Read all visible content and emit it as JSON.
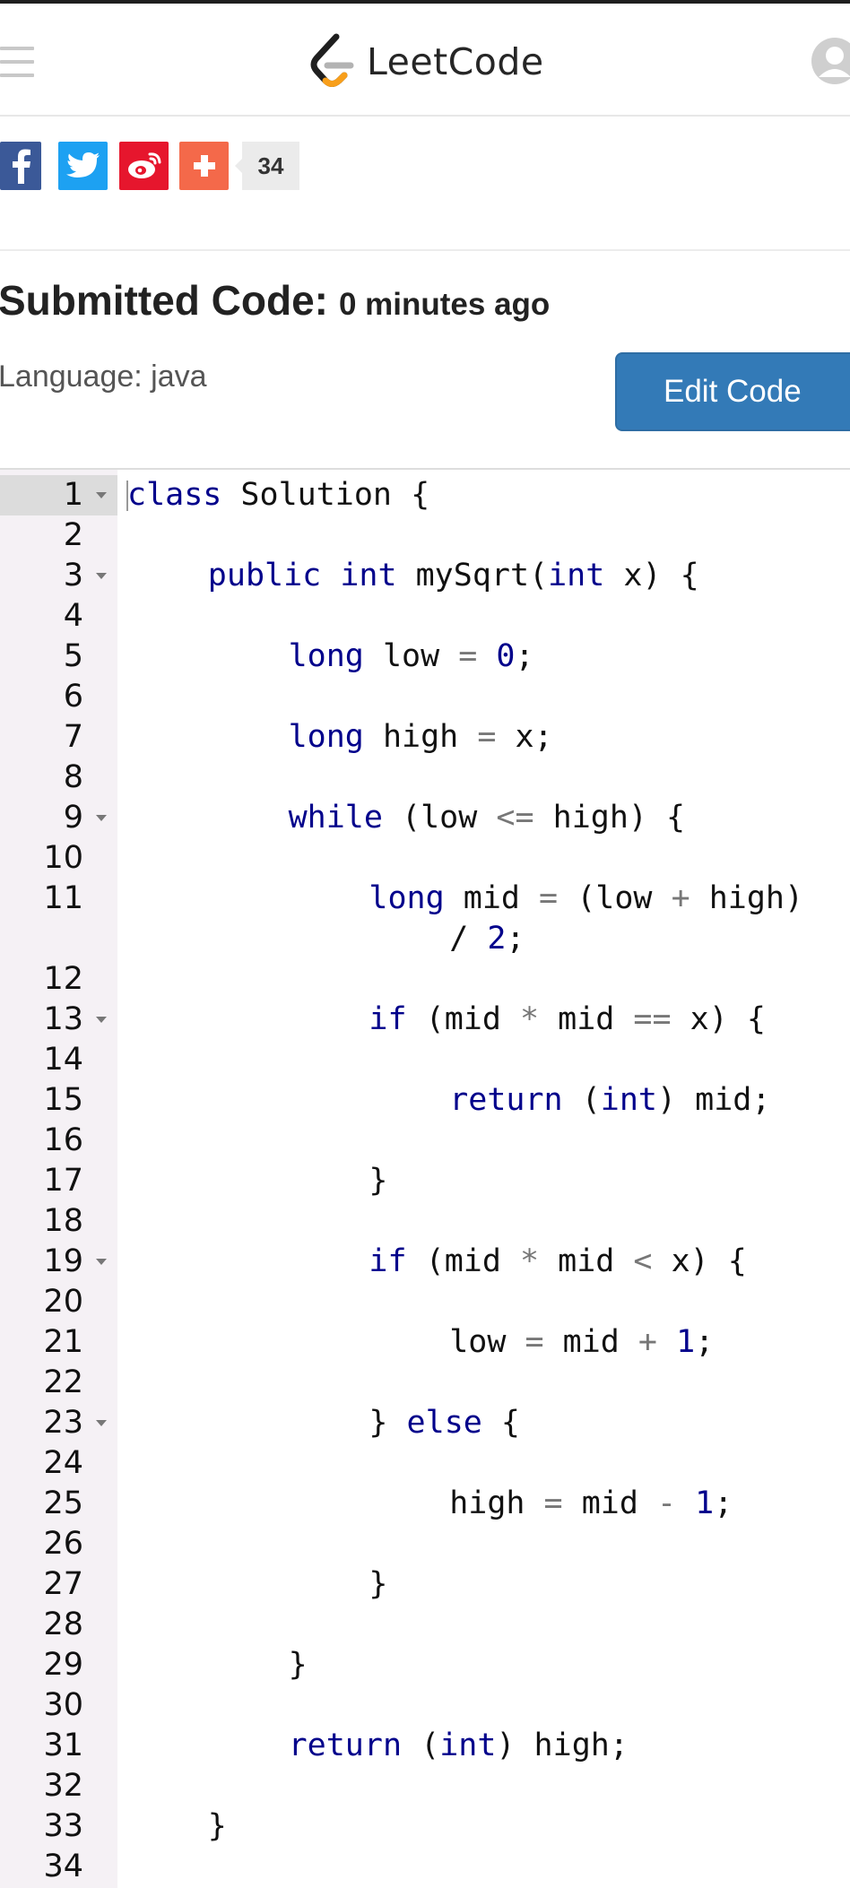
{
  "header": {
    "logo_text": "LeetCode",
    "menu_icon": "hamburger-icon",
    "avatar_icon": "user-avatar-icon"
  },
  "share": {
    "buttons": [
      {
        "name": "facebook",
        "icon": "facebook-icon",
        "color": "#3b5998"
      },
      {
        "name": "twitter",
        "icon": "twitter-icon",
        "color": "#1da1f2"
      },
      {
        "name": "weibo",
        "icon": "weibo-icon",
        "color": "#e6162d"
      },
      {
        "name": "more",
        "icon": "plus-icon",
        "color": "#f4694a"
      }
    ],
    "count": "34"
  },
  "submission": {
    "title": "Submitted Code:",
    "time_ago": "0 minutes ago",
    "language_label": "Language: java",
    "edit_button": "Edit Code",
    "edit_button_color": "#337ab7"
  },
  "editor": {
    "lines": [
      {
        "n": "1",
        "fold": true,
        "indent": 0,
        "tokens": [
          [
            "kw",
            "class"
          ],
          [
            "t",
            " Solution {"
          ]
        ]
      },
      {
        "n": "2",
        "fold": false,
        "indent": 0,
        "tokens": []
      },
      {
        "n": "3",
        "fold": true,
        "indent": 4,
        "tokens": [
          [
            "kw",
            "public"
          ],
          [
            "t",
            " "
          ],
          [
            "kw",
            "int"
          ],
          [
            "t",
            " mySqrt("
          ],
          [
            "kw",
            "int"
          ],
          [
            "t",
            " x) {"
          ]
        ]
      },
      {
        "n": "4",
        "fold": false,
        "indent": 0,
        "tokens": []
      },
      {
        "n": "5",
        "fold": false,
        "indent": 8,
        "tokens": [
          [
            "kw",
            "long"
          ],
          [
            "t",
            " low "
          ],
          [
            "op",
            "="
          ],
          [
            "t",
            " "
          ],
          [
            "num",
            "0"
          ],
          [
            "t",
            ";"
          ]
        ]
      },
      {
        "n": "6",
        "fold": false,
        "indent": 0,
        "tokens": []
      },
      {
        "n": "7",
        "fold": false,
        "indent": 8,
        "tokens": [
          [
            "kw",
            "long"
          ],
          [
            "t",
            " high "
          ],
          [
            "op",
            "="
          ],
          [
            "t",
            " x;"
          ]
        ]
      },
      {
        "n": "8",
        "fold": false,
        "indent": 0,
        "tokens": []
      },
      {
        "n": "9",
        "fold": true,
        "indent": 8,
        "tokens": [
          [
            "kw",
            "while"
          ],
          [
            "t",
            " (low "
          ],
          [
            "op",
            "<="
          ],
          [
            "t",
            " high) {"
          ]
        ]
      },
      {
        "n": "10",
        "fold": false,
        "indent": 0,
        "tokens": []
      },
      {
        "n": "11",
        "fold": false,
        "indent": 12,
        "tokens": [
          [
            "kw",
            "long"
          ],
          [
            "t",
            " mid "
          ],
          [
            "op",
            "="
          ],
          [
            "t",
            " (low "
          ],
          [
            "op",
            "+"
          ],
          [
            "t",
            " high)"
          ]
        ]
      },
      {
        "n": "",
        "fold": false,
        "indent": 16,
        "tokens": [
          [
            "t",
            "/ "
          ],
          [
            "num",
            "2"
          ],
          [
            "t",
            ";"
          ]
        ]
      },
      {
        "n": "12",
        "fold": false,
        "indent": 0,
        "tokens": []
      },
      {
        "n": "13",
        "fold": true,
        "indent": 12,
        "tokens": [
          [
            "kw",
            "if"
          ],
          [
            "t",
            " (mid "
          ],
          [
            "op",
            "*"
          ],
          [
            "t",
            " mid "
          ],
          [
            "op",
            "=="
          ],
          [
            "t",
            " x) {"
          ]
        ]
      },
      {
        "n": "14",
        "fold": false,
        "indent": 0,
        "tokens": []
      },
      {
        "n": "15",
        "fold": false,
        "indent": 16,
        "tokens": [
          [
            "kw",
            "return"
          ],
          [
            "t",
            " ("
          ],
          [
            "kw",
            "int"
          ],
          [
            "t",
            ") mid;"
          ]
        ]
      },
      {
        "n": "16",
        "fold": false,
        "indent": 0,
        "tokens": []
      },
      {
        "n": "17",
        "fold": false,
        "indent": 12,
        "tokens": [
          [
            "t",
            "}"
          ]
        ]
      },
      {
        "n": "18",
        "fold": false,
        "indent": 0,
        "tokens": []
      },
      {
        "n": "19",
        "fold": true,
        "indent": 12,
        "tokens": [
          [
            "kw",
            "if"
          ],
          [
            "t",
            " (mid "
          ],
          [
            "op",
            "*"
          ],
          [
            "t",
            " mid "
          ],
          [
            "op",
            "<"
          ],
          [
            "t",
            " x) {"
          ]
        ]
      },
      {
        "n": "20",
        "fold": false,
        "indent": 0,
        "tokens": []
      },
      {
        "n": "21",
        "fold": false,
        "indent": 16,
        "tokens": [
          [
            "t",
            "low "
          ],
          [
            "op",
            "="
          ],
          [
            "t",
            " mid "
          ],
          [
            "op",
            "+"
          ],
          [
            "t",
            " "
          ],
          [
            "num",
            "1"
          ],
          [
            "t",
            ";"
          ]
        ]
      },
      {
        "n": "22",
        "fold": false,
        "indent": 0,
        "tokens": []
      },
      {
        "n": "23",
        "fold": true,
        "indent": 12,
        "tokens": [
          [
            "t",
            "} "
          ],
          [
            "kw",
            "else"
          ],
          [
            "t",
            " {"
          ]
        ]
      },
      {
        "n": "24",
        "fold": false,
        "indent": 0,
        "tokens": []
      },
      {
        "n": "25",
        "fold": false,
        "indent": 16,
        "tokens": [
          [
            "t",
            "high "
          ],
          [
            "op",
            "="
          ],
          [
            "t",
            " mid "
          ],
          [
            "op",
            "-"
          ],
          [
            "t",
            " "
          ],
          [
            "num",
            "1"
          ],
          [
            "t",
            ";"
          ]
        ]
      },
      {
        "n": "26",
        "fold": false,
        "indent": 0,
        "tokens": []
      },
      {
        "n": "27",
        "fold": false,
        "indent": 12,
        "tokens": [
          [
            "t",
            "}"
          ]
        ]
      },
      {
        "n": "28",
        "fold": false,
        "indent": 0,
        "tokens": []
      },
      {
        "n": "29",
        "fold": false,
        "indent": 8,
        "tokens": [
          [
            "t",
            "}"
          ]
        ]
      },
      {
        "n": "30",
        "fold": false,
        "indent": 0,
        "tokens": []
      },
      {
        "n": "31",
        "fold": false,
        "indent": 8,
        "tokens": [
          [
            "kw",
            "return"
          ],
          [
            "t",
            " ("
          ],
          [
            "kw",
            "int"
          ],
          [
            "t",
            ") high;"
          ]
        ]
      },
      {
        "n": "32",
        "fold": false,
        "indent": 0,
        "tokens": []
      },
      {
        "n": "33",
        "fold": false,
        "indent": 4,
        "tokens": [
          [
            "t",
            "}"
          ]
        ]
      },
      {
        "n": "34",
        "fold": false,
        "indent": 0,
        "tokens": []
      }
    ]
  }
}
